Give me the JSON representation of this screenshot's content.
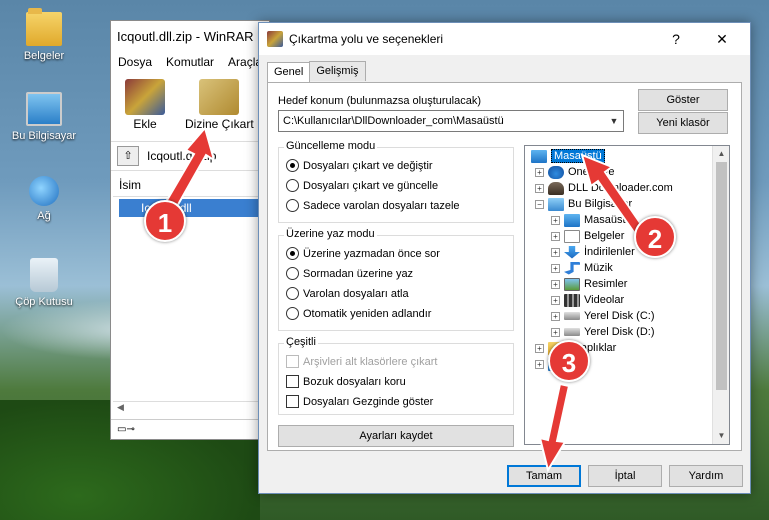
{
  "desktop": {
    "icons": [
      {
        "label": "Belgeler",
        "icon": "folder-icon"
      },
      {
        "label": "Bu Bilgisayar",
        "icon": "computer-icon"
      },
      {
        "label": "Ağ",
        "icon": "network-icon"
      },
      {
        "label": "Çöp Kutusu",
        "icon": "recycle-bin-icon"
      }
    ]
  },
  "winrar": {
    "title": "Icqoutl.dll.zip - WinRAR",
    "menu": [
      "Dosya",
      "Komutlar",
      "Araçlar"
    ],
    "toolbar": {
      "add_label": "Ekle",
      "extract_label": "Dizine Çıkart"
    },
    "path": "Icqoutl.dll.zip",
    "column_name": "İsim",
    "file": "Icqoutl.dll"
  },
  "dialog": {
    "title": "Çıkartma yolu ve seçenekleri",
    "help_btn": "?",
    "close_btn": "✕",
    "tabs": [
      "Genel",
      "Gelişmiş"
    ],
    "dest_label": "Hedef konum (bulunmazsa oluşturulacak)",
    "dest_value": "C:\\Kullanıcılar\\DllDownloader_com\\Masaüstü",
    "show_btn": "Göster",
    "new_folder_btn": "Yeni klasör",
    "update_group": {
      "title": "Güncelleme modu",
      "options": [
        "Dosyaları çıkart ve değiştir",
        "Dosyaları çıkart ve güncelle",
        "Sadece varolan dosyaları tazele"
      ],
      "selected": 0
    },
    "overwrite_group": {
      "title": "Üzerine yaz modu",
      "options": [
        "Üzerine yazmadan önce sor",
        "Sormadan üzerine yaz",
        "Varolan dosyaları atla",
        "Otomatik yeniden adlandır"
      ],
      "selected": 0
    },
    "misc_group": {
      "title": "Çeşitli",
      "options": [
        "Arşivleri alt klasörlere çıkart",
        "Bozuk dosyaları koru",
        "Dosyaları Gezginde göster"
      ],
      "disabled": [
        true,
        false,
        false
      ]
    },
    "save_settings_btn": "Ayarları kaydet",
    "tree": [
      {
        "label": "Masaüstü",
        "icon": "desktop-icon",
        "selected": true
      },
      {
        "label": "OneDrive",
        "icon": "onedrive-icon"
      },
      {
        "label": "DLL Downloader.com",
        "icon": "user-icon"
      },
      {
        "label": "Bu Bilgisayar",
        "icon": "computer-icon"
      },
      {
        "label": "Masaüstü",
        "icon": "desktop-icon"
      },
      {
        "label": "Belgeler",
        "icon": "documents-icon"
      },
      {
        "label": "İndirilenler",
        "icon": "downloads-icon"
      },
      {
        "label": "Müzik",
        "icon": "music-icon"
      },
      {
        "label": "Resimler",
        "icon": "pictures-icon"
      },
      {
        "label": "Videolar",
        "icon": "videos-icon"
      },
      {
        "label": "Yerel Disk (C:)",
        "icon": "disk-icon"
      },
      {
        "label": "Yerel Disk (D:)",
        "icon": "disk-icon"
      },
      {
        "label": "Kitaplıklar",
        "icon": "libraries-icon"
      },
      {
        "label": "Ağ",
        "icon": "network-icon"
      }
    ],
    "ok_btn": "Tamam",
    "cancel_btn": "İptal",
    "help_button": "Yardım"
  },
  "markers": [
    "1",
    "2",
    "3"
  ],
  "colors": {
    "marker": "#e53935",
    "selection": "#0078d7"
  }
}
